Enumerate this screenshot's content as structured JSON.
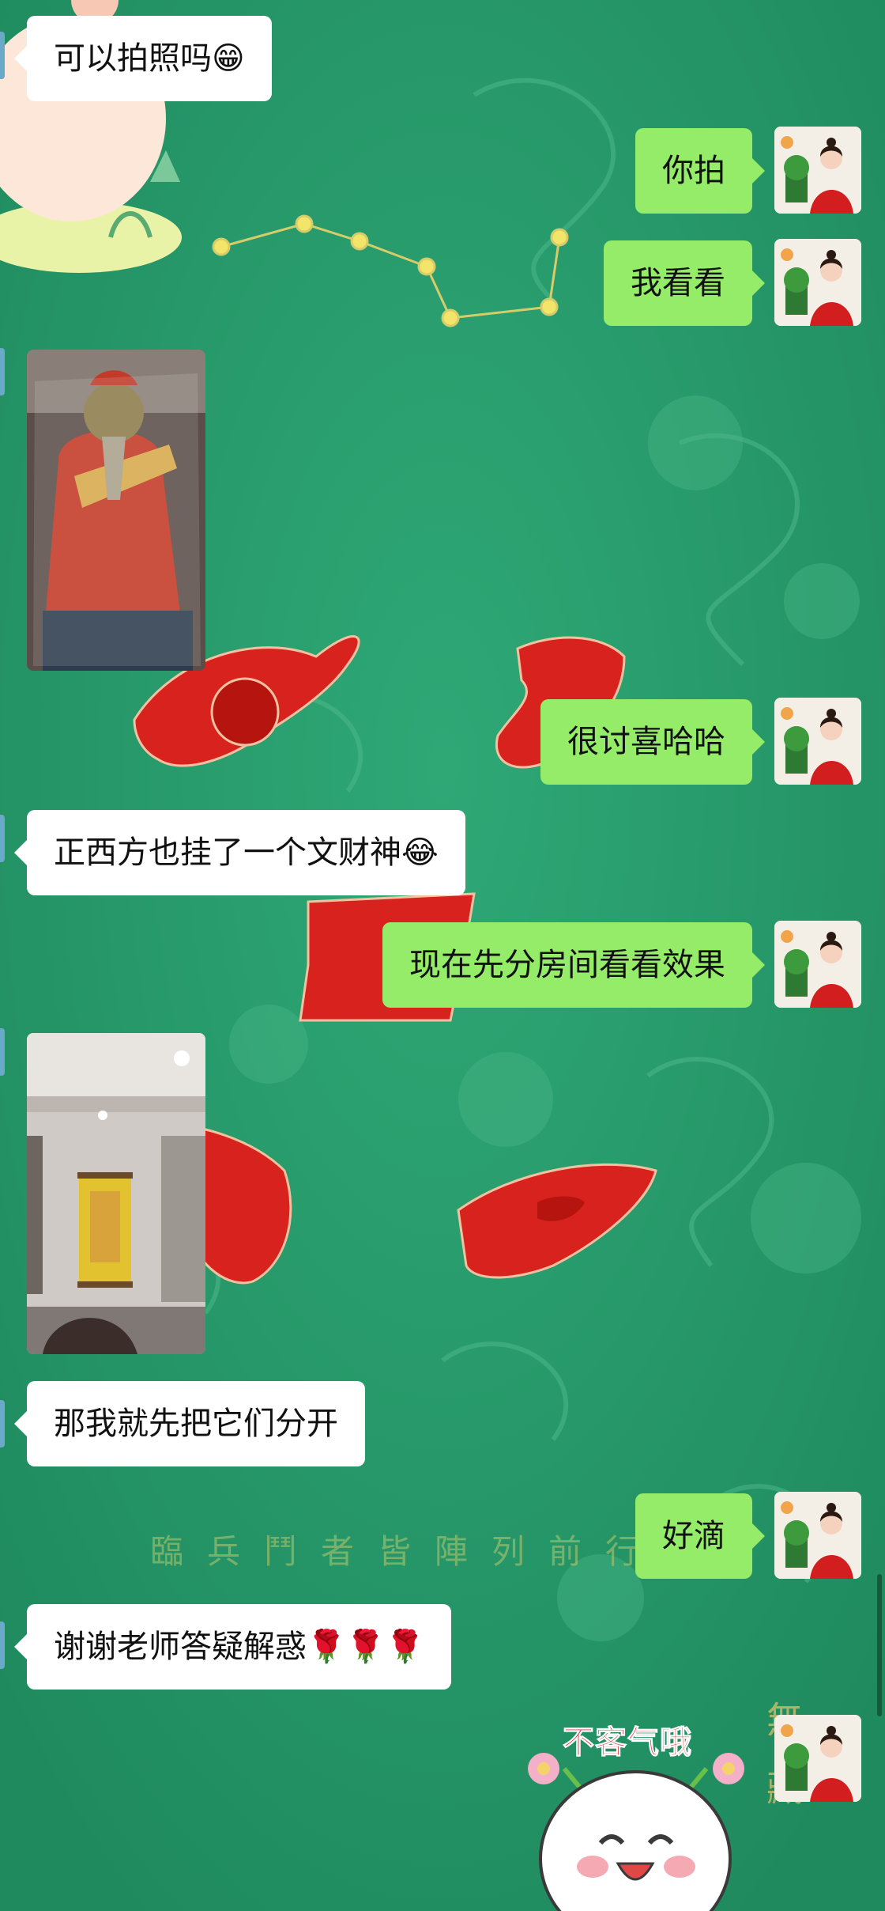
{
  "messages": [
    {
      "side": "in",
      "text": "可以拍照吗😁"
    },
    {
      "side": "out",
      "text": "你拍"
    },
    {
      "side": "out",
      "text": "我看看"
    },
    {
      "side": "in",
      "type": "image",
      "description_icon": "statue-photo"
    },
    {
      "side": "out",
      "text": "很讨喜哈哈"
    },
    {
      "side": "in",
      "text": "正西方也挂了一个文财神😂"
    },
    {
      "side": "out",
      "text": "现在先分房间看看效果"
    },
    {
      "side": "in",
      "type": "image",
      "description_icon": "room-photo"
    },
    {
      "side": "in",
      "text": "那我就先把它们分开"
    },
    {
      "side": "out",
      "text": "好滴"
    },
    {
      "side": "in",
      "text": "谢谢老师答疑解惑🌹🌹🌹"
    },
    {
      "side": "out",
      "type": "sticker",
      "text": "不客气哦"
    }
  ],
  "background": {
    "base_color": "#279a6a",
    "watermark_text": "臨兵鬥者皆陣列前行",
    "corner_text": "無藏"
  },
  "colors": {
    "outgoing_bubble": "#95ec69",
    "incoming_bubble": "#ffffff"
  }
}
